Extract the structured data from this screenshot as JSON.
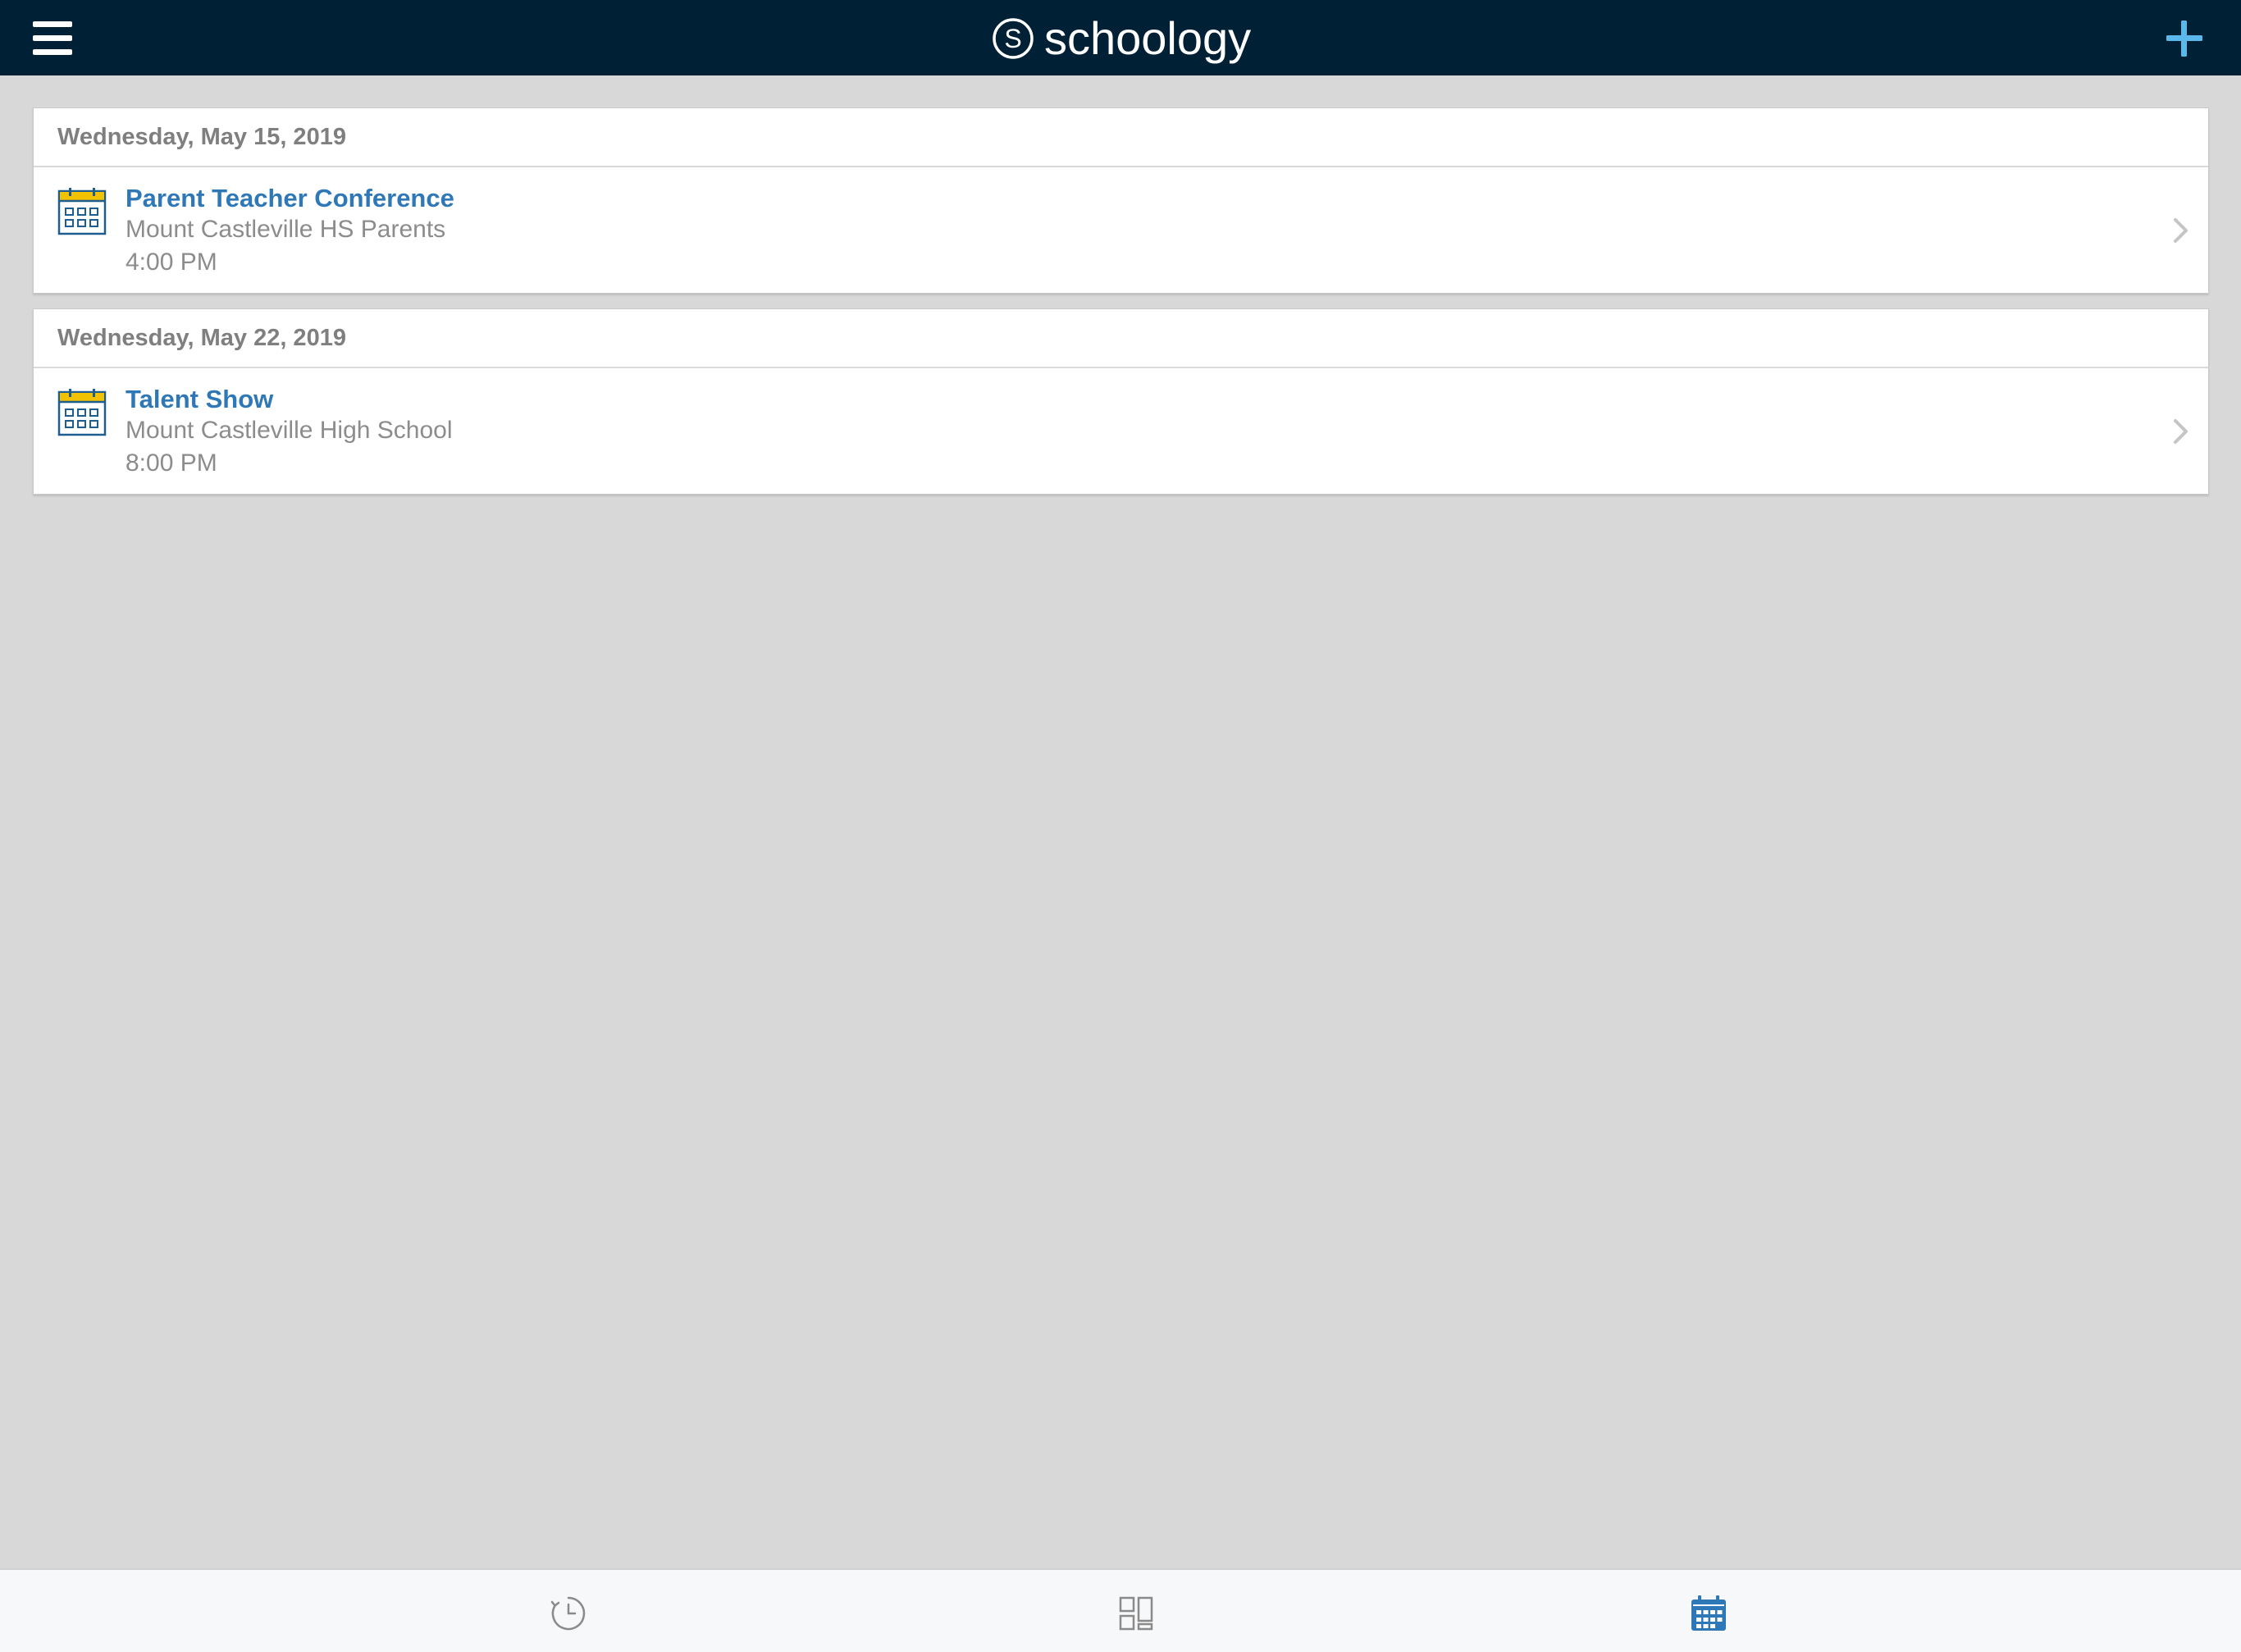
{
  "header": {
    "app_name": "schoology",
    "logo_letter": "S",
    "menu_icon": "hamburger-menu-icon",
    "add_icon": "plus-icon"
  },
  "days": [
    {
      "date": "Wednesday, May 15, 2019",
      "events": [
        {
          "title": "Parent Teacher Conference",
          "subtitle": "Mount Castleville HS Parents",
          "time": "4:00 PM"
        }
      ]
    },
    {
      "date": "Wednesday, May 22, 2019",
      "events": [
        {
          "title": "Talent Show",
          "subtitle": "Mount Castleville High School",
          "time": "8:00 PM"
        }
      ]
    }
  ],
  "tabbar": {
    "tabs": [
      {
        "icon": "recent-activity-icon",
        "active": false
      },
      {
        "icon": "courses-grid-icon",
        "active": false
      },
      {
        "icon": "calendar-icon",
        "active": true
      }
    ]
  },
  "colors": {
    "header_bg": "#002035",
    "accent_blue": "#2f78b7",
    "add_button": "#5bb8ea",
    "calendar_yellow": "#f2c200",
    "background": "#d8d8d9"
  }
}
